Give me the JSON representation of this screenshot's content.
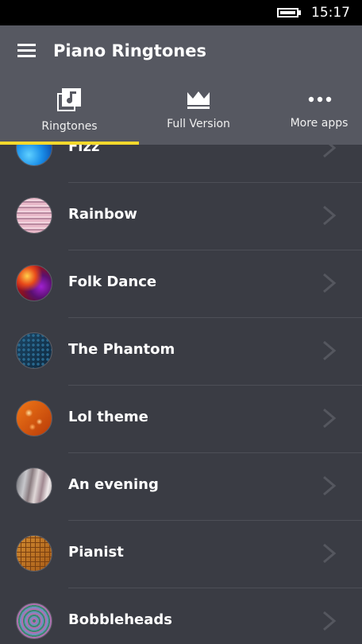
{
  "status_bar": {
    "time": "15:17"
  },
  "header": {
    "title": "Piano Ringtones"
  },
  "tabs": [
    {
      "label": "Ringtones",
      "icon": "music-library-icon",
      "active": true
    },
    {
      "label": "Full Version",
      "icon": "crown-icon",
      "active": false
    },
    {
      "label": "More apps",
      "icon": "more-dots-icon",
      "active": false
    }
  ],
  "colors": {
    "accent": "#f4d92c",
    "header_bg": "#565861",
    "list_bg": "#3a3c44",
    "status_bar_bg": "#000000"
  },
  "ringtones": [
    {
      "name": "Fizz"
    },
    {
      "name": "Rainbow"
    },
    {
      "name": "Folk Dance"
    },
    {
      "name": "The Phantom"
    },
    {
      "name": "Lol theme"
    },
    {
      "name": "An evening"
    },
    {
      "name": "Pianist"
    },
    {
      "name": "Bobbleheads"
    }
  ]
}
